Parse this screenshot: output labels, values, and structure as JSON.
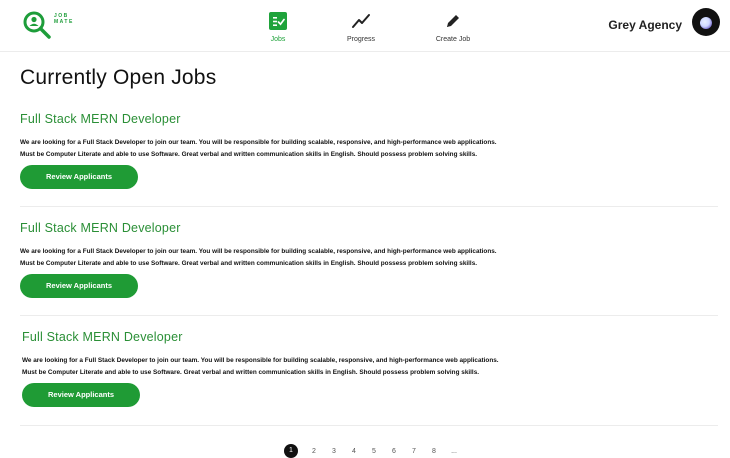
{
  "brand": {
    "logo_text_line1": "JOB",
    "logo_text_line2": "MATE"
  },
  "nav": {
    "items": [
      {
        "label": "Jobs",
        "icon": "jobs-checklist-icon",
        "active": true
      },
      {
        "label": "Progress",
        "icon": "trend-line-icon",
        "active": false
      },
      {
        "label": "Create Job",
        "icon": "pencil-icon",
        "active": false
      }
    ]
  },
  "user": {
    "name": "Grey Agency"
  },
  "page": {
    "title": "Currently Open Jobs"
  },
  "jobs": [
    {
      "title": "Full Stack MERN Developer",
      "desc_line1": "We are looking for a Full Stack Developer to join our team. You will be responsible for building scalable, responsive, and high-performance web applications.",
      "desc_line2": "Must be Computer Literate and able to use Software. Great verbal and written communication skills in English. Should possess problem solving skills.",
      "button": "Review Applicants"
    },
    {
      "title": "Full Stack MERN Developer",
      "desc_line1": "We are looking for a Full Stack Developer to join our team. You will be responsible for building scalable, responsive, and high-performance web applications.",
      "desc_line2": "Must be Computer Literate and able to use Software. Great verbal and written communication skills in English. Should possess problem solving skills.",
      "button": "Review Applicants"
    },
    {
      "title": "Full Stack MERN Developer",
      "desc_line1": "We are looking for a Full Stack Developer to join our team. You will be responsible for building scalable, responsive, and high-performance web applications.",
      "desc_line2": "Must be Computer Literate and able to use Software. Great verbal and written communication skills in English. Should possess problem solving skills.",
      "button": "Review Applicants"
    }
  ],
  "pagination": {
    "pages": [
      "1",
      "2",
      "3",
      "4",
      "5",
      "6",
      "7",
      "8",
      "..."
    ],
    "current": "1"
  },
  "colors": {
    "accent": "#1f9b35",
    "title_green": "#2a8f36"
  }
}
